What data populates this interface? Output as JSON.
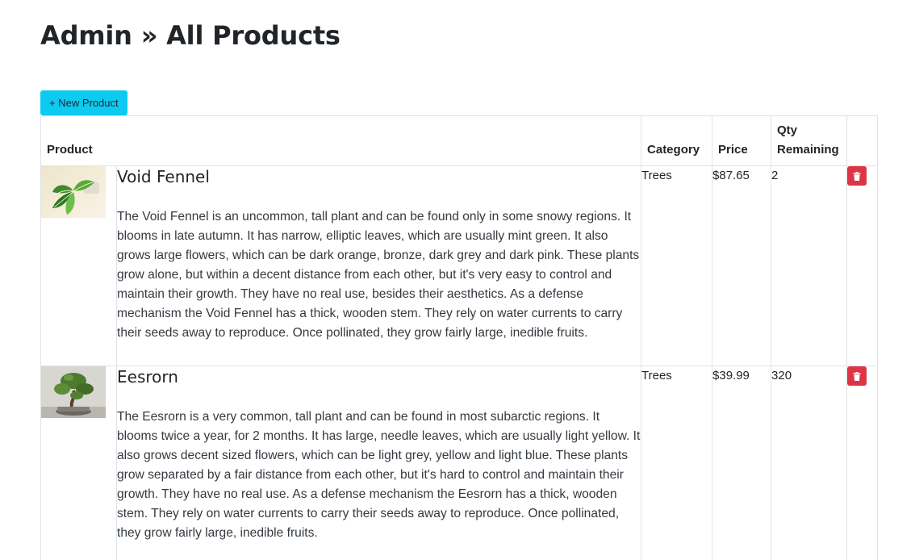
{
  "header": {
    "title": "Admin » All Products"
  },
  "toolbar": {
    "new_product_label": "+ New Product"
  },
  "table": {
    "columns": {
      "product": "Product",
      "category": "Category",
      "price": "Price",
      "qty": "Qty Remaining"
    },
    "rows": [
      {
        "image_icon": "potted-plant-leaves-photo",
        "name": "Void Fennel",
        "description": "The Void Fennel is an uncommon, tall plant and can be found only in some snowy regions. It blooms in late autumn. It has narrow, elliptic leaves, which are usually mint green. It also grows large flowers, which can be dark orange, bronze, dark grey and dark pink. These plants grow alone, but within a decent distance from each other, but it's very easy to control and maintain their growth. They have no real use, besides their aesthetics. As a defense mechanism the Void Fennel has a thick, wooden stem. They rely on water currents to carry their seeds away to reproduce. Once pollinated, they grow fairly large, inedible fruits.",
        "category": "Trees",
        "price": "$87.65",
        "qty": "2",
        "delete_icon": "trash-icon"
      },
      {
        "image_icon": "bonsai-tree-photo",
        "name": "Eesrorn",
        "description": "The Eesrorn is a very common, tall plant and can be found in most subarctic regions. It blooms twice a year, for 2 months. It has large, needle leaves, which are usually light yellow. It also grows decent sized flowers, which can be light grey, yellow and light blue. These plants grow separated by a fair distance from each other, but it's hard to control and maintain their growth. They have no real use. As a defense mechanism the Eesrorn has a thick, wooden stem. They rely on water currents to carry their seeds away to reproduce. Once pollinated, they grow fairly large, inedible fruits.",
        "category": "Trees",
        "price": "$39.99",
        "qty": "320",
        "delete_icon": "trash-icon"
      }
    ]
  },
  "colors": {
    "new_button_bg": "#0dcaf0",
    "delete_button_bg": "#dc3545",
    "border": "#dee2e6"
  }
}
